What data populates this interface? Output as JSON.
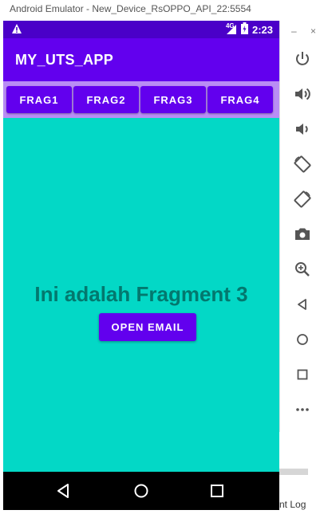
{
  "window": {
    "title": "Android Emulator - New_Device_RsOPPO_API_22:5554"
  },
  "status_bar": {
    "network": "4G",
    "time": "2:23"
  },
  "app_bar": {
    "title": "MY_UTS_APP"
  },
  "tabs": [
    {
      "label": "FRAG1"
    },
    {
      "label": "FRAG2"
    },
    {
      "label": "FRAG3"
    },
    {
      "label": "FRAG4"
    }
  ],
  "content": {
    "heading": "Ini adalah Fragment 3",
    "button_label": "OPEN EMAIL"
  },
  "side_panel": {
    "minimize": "–",
    "close": "×",
    "icons": [
      "power-icon",
      "volume-up-icon",
      "volume-down-icon",
      "rotate-left-icon",
      "rotate-right-icon",
      "camera-icon",
      "zoom-icon",
      "back-icon",
      "home-icon",
      "overview-icon",
      "more-icon"
    ]
  },
  "bottom_label": "nt Log",
  "colors": {
    "status_bar": "#4a00c8",
    "primary": "#6200ee",
    "tab_strip": "#b98df5",
    "content_bg": "#03d8c6",
    "heading": "#03786e"
  }
}
